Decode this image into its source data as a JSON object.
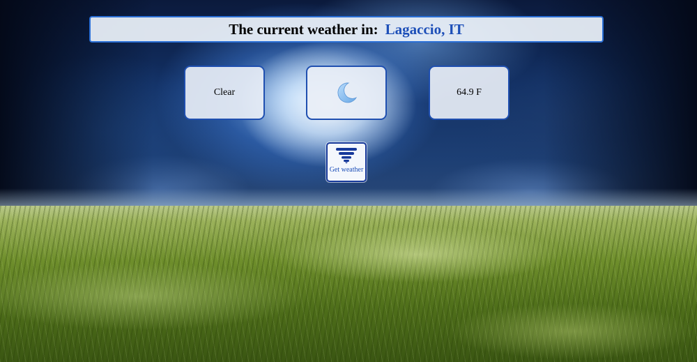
{
  "header": {
    "prefix": "The current weather in:",
    "location": "Lagaccio, IT"
  },
  "weather": {
    "condition": "Clear",
    "icon": "crescent-moon-icon",
    "temperature": "64.9 F"
  },
  "action": {
    "button_label": "Get weather",
    "icon": "funnel-tornado-icon"
  },
  "colors": {
    "accent": "#1d4fb8",
    "border": "#2a6fd6"
  }
}
